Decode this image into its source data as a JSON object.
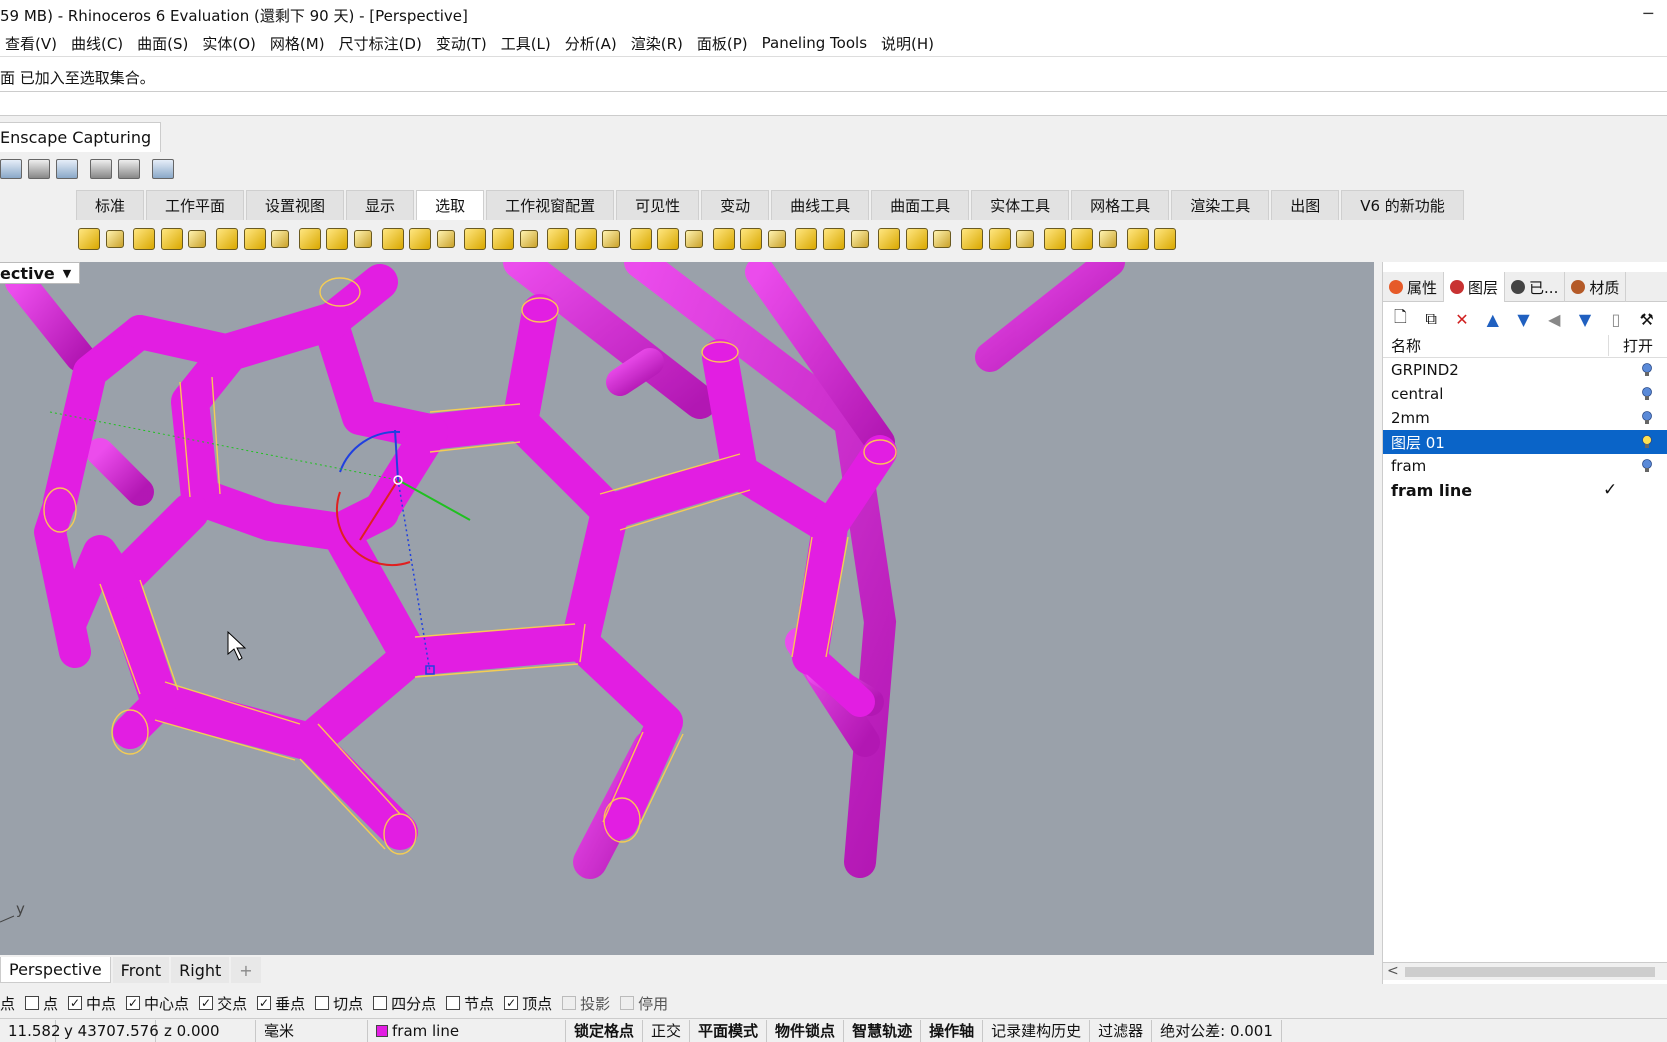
{
  "window": {
    "title": "59 MB) - Rhinoceros 6 Evaluation (還剩下 90 天) - [Perspective]",
    "minimize_glyph": "─"
  },
  "menu": [
    "查看(V)",
    "曲线(C)",
    "曲面(S)",
    "实体(O)",
    "网格(M)",
    "尺寸标注(D)",
    "变动(T)",
    "工具(L)",
    "分析(A)",
    "渲染(R)",
    "面板(P)",
    "Paneling Tools",
    "说明(H)"
  ],
  "command_history": {
    "line": "面 已加入至选取集合。"
  },
  "toolbar_panel": {
    "label": "Enscape Capturing"
  },
  "tabs": [
    "标准",
    "工作平面",
    "设置视图",
    "显示",
    "选取",
    "工作视窗配置",
    "可见性",
    "变动",
    "曲线工具",
    "曲面工具",
    "实体工具",
    "网格工具",
    "渲染工具",
    "出图",
    "V6 的新功能"
  ],
  "active_tab": "选取",
  "viewport": {
    "label": "ective",
    "axis_label": "y",
    "background": "#9aa1aa",
    "tube_color": "#e21ee2",
    "highlight_color": "#ffd24a"
  },
  "side_panel": {
    "tabs": [
      {
        "label": "属性",
        "icon": "palette-icon",
        "color": "#e65a28"
      },
      {
        "label": "图层",
        "icon": "layers-icon",
        "color": "#c83232"
      },
      {
        "label": "已...",
        "icon": "camera-icon",
        "color": "#444444"
      },
      {
        "label": "材质",
        "icon": "brush-icon",
        "color": "#b45a28"
      }
    ],
    "active_tab": "图层",
    "columns": {
      "name": "名称",
      "on": "打开"
    },
    "layers": [
      {
        "name": "GRPIND2",
        "selected": false,
        "current": false
      },
      {
        "name": "central",
        "selected": false,
        "current": false
      },
      {
        "name": "2mm",
        "selected": false,
        "current": false
      },
      {
        "name": "图层 01",
        "selected": true,
        "current": false
      },
      {
        "name": "fram",
        "selected": false,
        "current": false
      },
      {
        "name": "fram line",
        "selected": false,
        "current": true
      }
    ],
    "check_glyph": "✓",
    "scroll_left": "<"
  },
  "viewport_tabs": [
    "Perspective",
    "Front",
    "Right",
    "+"
  ],
  "active_viewport_tab": "Perspective",
  "osnaps": [
    {
      "label": "点",
      "checked": false,
      "partial": true
    },
    {
      "label": "点",
      "checked": false
    },
    {
      "label": "中点",
      "checked": true
    },
    {
      "label": "中心点",
      "checked": true
    },
    {
      "label": "交点",
      "checked": true
    },
    {
      "label": "垂点",
      "checked": true
    },
    {
      "label": "切点",
      "checked": false
    },
    {
      "label": "四分点",
      "checked": false
    },
    {
      "label": "节点",
      "checked": false
    },
    {
      "label": "顶点",
      "checked": true
    },
    {
      "label": "投影",
      "checked": false,
      "disabled": true
    },
    {
      "label": "停用",
      "checked": false,
      "disabled": true
    }
  ],
  "status": {
    "x": "11.582",
    "y": "y 43707.576",
    "z": "z 0.000",
    "units": "毫米",
    "layer": "fram line",
    "layer_color": "#e21ee2",
    "toggles": [
      "锁定格点",
      "正交",
      "平面模式",
      "物件锁点",
      "智慧轨迹",
      "操作轴"
    ],
    "bold_toggles": [
      "锁定格点",
      "平面模式",
      "物件锁点",
      "智慧轨迹",
      "操作轴"
    ],
    "history": "记录建构历史",
    "filter": "过滤器",
    "tolerance": "绝对公差: 0.001"
  }
}
